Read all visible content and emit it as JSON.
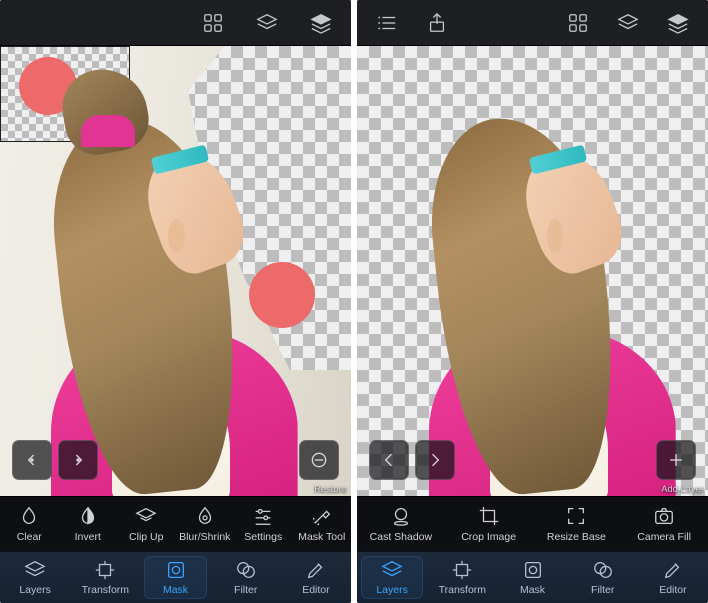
{
  "left": {
    "top_icons": [
      "grid-icon",
      "stack-outline-icon",
      "stack-filled-icon"
    ],
    "float": {
      "undo": "undo-icon",
      "redo": "redo-icon",
      "restore": "restore-icon",
      "restore_label": "Restore"
    },
    "tools": [
      {
        "icon": "droplet-clear-icon",
        "label": "Clear"
      },
      {
        "icon": "droplet-invert-icon",
        "label": "Invert"
      },
      {
        "icon": "clipup-icon",
        "label": "Clip Up"
      },
      {
        "icon": "blur-icon",
        "label": "Blur/Shrink"
      },
      {
        "icon": "sliders-icon",
        "label": "Settings"
      },
      {
        "icon": "wand-icon",
        "label": "Mask Tool"
      }
    ],
    "tabs": [
      {
        "icon": "layers-icon",
        "label": "Layers",
        "active": false
      },
      {
        "icon": "transform-icon",
        "label": "Transform",
        "active": false
      },
      {
        "icon": "mask-icon",
        "label": "Mask",
        "active": true
      },
      {
        "icon": "filter-icon",
        "label": "Filter",
        "active": false
      },
      {
        "icon": "editor-icon",
        "label": "Editor",
        "active": false
      }
    ]
  },
  "right": {
    "top_icons": [
      "list-icon",
      "share-icon",
      "grid-icon",
      "stack-outline-icon",
      "stack-filled-icon"
    ],
    "float": {
      "prev": "chevron-left-icon",
      "next": "chevron-right-icon",
      "add": "plus-icon",
      "add_label": "Add Layer"
    },
    "tools": [
      {
        "icon": "shadow-icon",
        "label": "Cast Shadow"
      },
      {
        "icon": "crop-icon",
        "label": "Crop Image"
      },
      {
        "icon": "resize-icon",
        "label": "Resize Base"
      },
      {
        "icon": "camerafill-icon",
        "label": "Camera Fill"
      }
    ],
    "tabs": [
      {
        "icon": "layers-icon",
        "label": "Layers",
        "active": true
      },
      {
        "icon": "transform-icon",
        "label": "Transform",
        "active": false
      },
      {
        "icon": "mask-icon",
        "label": "Mask",
        "active": false
      },
      {
        "icon": "filter-icon",
        "label": "Filter",
        "active": false
      },
      {
        "icon": "editor-icon",
        "label": "Editor",
        "active": false
      }
    ]
  }
}
